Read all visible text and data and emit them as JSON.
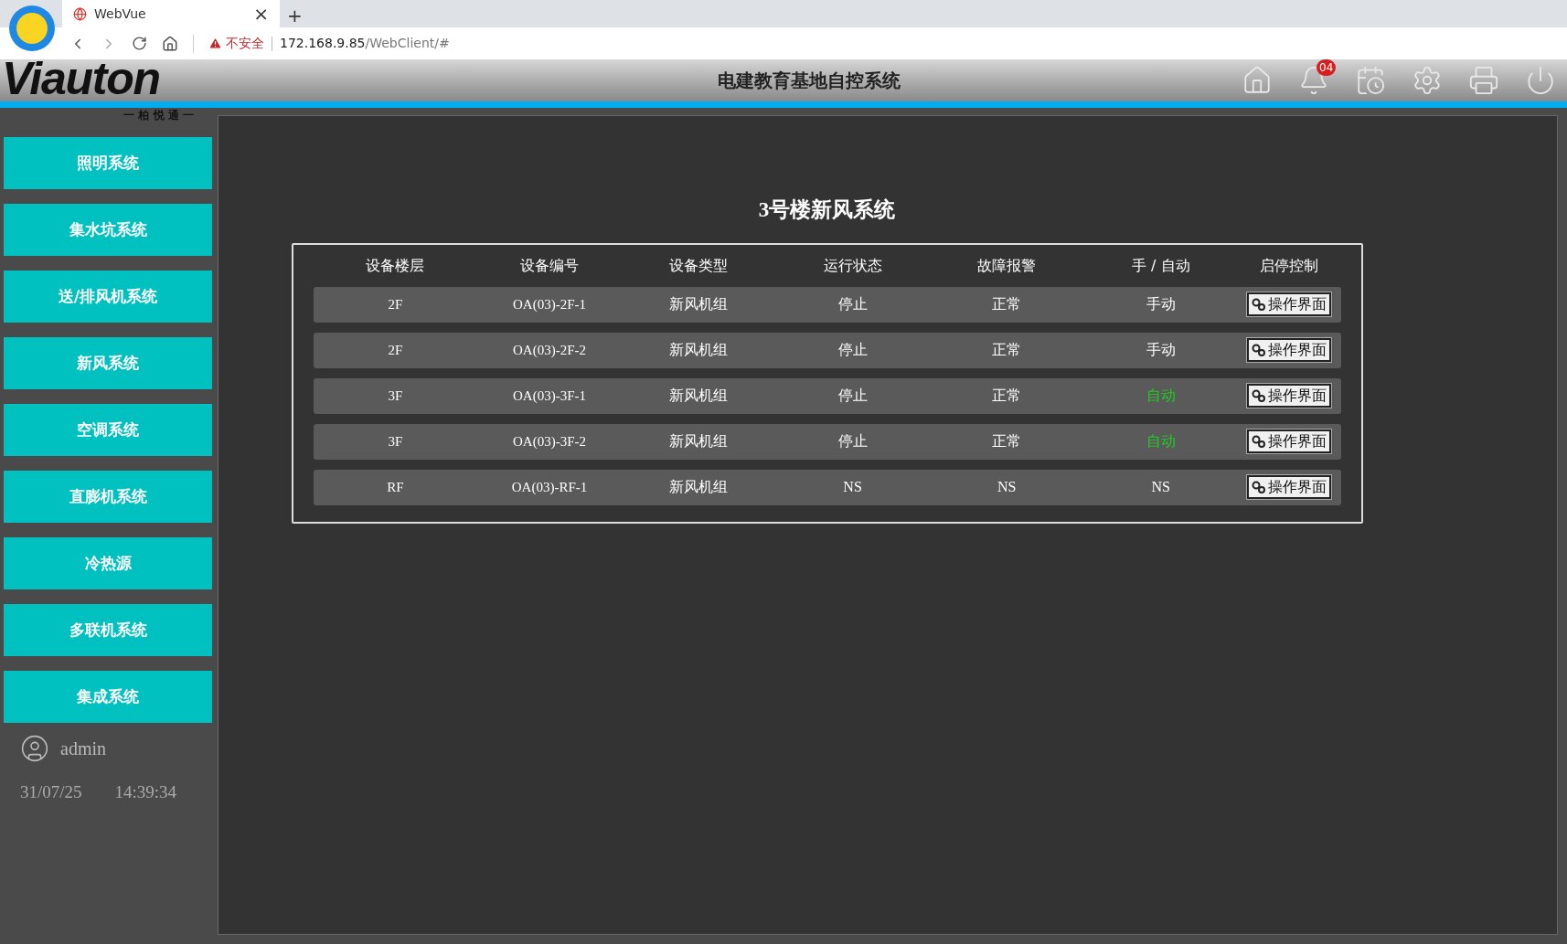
{
  "browser": {
    "tab": {
      "title": "WebVue",
      "close": "×"
    },
    "new_tab": "+",
    "security": "不安全",
    "url_host": "172.168.9.85",
    "url_path": "/WebClient/#"
  },
  "header": {
    "logo": "Viauton",
    "logo_subtitle": "一 柏 悦 通 一",
    "title": "电建教育基地自控系统",
    "notification_count": "04"
  },
  "sidebar": {
    "items": [
      {
        "label": "照明系统"
      },
      {
        "label": "集水坑系统"
      },
      {
        "label": "送/排风机系统"
      },
      {
        "label": "新风系统"
      },
      {
        "label": "空调系统"
      },
      {
        "label": "直膨机系统"
      },
      {
        "label": "冷热源"
      },
      {
        "label": "多联机系统"
      },
      {
        "label": "集成系统"
      }
    ],
    "user": "admin",
    "date": "31/07/25",
    "time": "14:39:34"
  },
  "main": {
    "title": "3号楼新风系统",
    "table": {
      "columns": [
        "设备楼层",
        "设备编号",
        "设备类型",
        "运行状态",
        "故障报警",
        "手 / 自动",
        "启停控制"
      ],
      "rows": [
        {
          "floor": "2F",
          "id": "OA(03)-2F-1",
          "type": "新风机组",
          "run": "停止",
          "alarm": "正常",
          "mode": "手动",
          "mode_auto": false,
          "action": "操作界面"
        },
        {
          "floor": "2F",
          "id": "OA(03)-2F-2",
          "type": "新风机组",
          "run": "停止",
          "alarm": "正常",
          "mode": "手动",
          "mode_auto": false,
          "action": "操作界面"
        },
        {
          "floor": "3F",
          "id": "OA(03)-3F-1",
          "type": "新风机组",
          "run": "停止",
          "alarm": "正常",
          "mode": "自动",
          "mode_auto": true,
          "action": "操作界面"
        },
        {
          "floor": "3F",
          "id": "OA(03)-3F-2",
          "type": "新风机组",
          "run": "停止",
          "alarm": "正常",
          "mode": "自动",
          "mode_auto": true,
          "action": "操作界面"
        },
        {
          "floor": "RF",
          "id": "OA(03)-RF-1",
          "type": "新风机组",
          "run": "NS",
          "alarm": "NS",
          "mode": "NS",
          "mode_auto": false,
          "action": "操作界面"
        }
      ]
    }
  }
}
